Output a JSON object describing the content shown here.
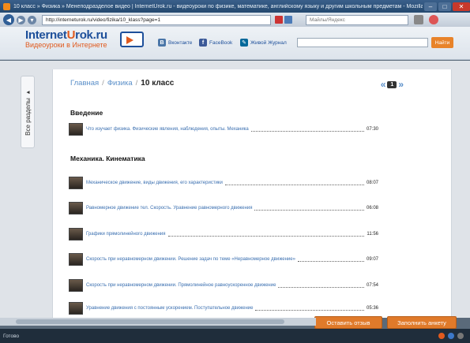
{
  "window": {
    "title": "10 класс » Физика » Менеподразделое видео | InternetUrok.ru - видеоуроки по физике, математике, английскому языку и другим школьным предметам - Mozilla Firefox"
  },
  "browser": {
    "url": "http://interneturok.ru/video/fizika/10_klass?page=1",
    "search_placeholder": "Майлы/Яндекс"
  },
  "site": {
    "logo_name_a": "Internet",
    "logo_name_b": "U",
    "logo_name_c": "rok.ru",
    "tagline": "Видеоуроки в Интернете",
    "social": [
      {
        "icon": "vkontakte-icon",
        "label": "Вконтакте",
        "color": "#4a76a8",
        "glyph": "B"
      },
      {
        "icon": "facebook-icon",
        "label": "FaceBook",
        "color": "#3b5998",
        "glyph": "f"
      },
      {
        "icon": "livejournal-icon",
        "label": "Живой Журнал",
        "color": "#00689a",
        "glyph": "✎"
      }
    ],
    "search_button": "Найти",
    "accent": "#e07a2a"
  },
  "sidebar": {
    "toggle_label": "Все разделы ▸"
  },
  "breadcrumb": {
    "home": "Главная",
    "subject": "Физика",
    "current": "10 класс",
    "sep": "/"
  },
  "pager": {
    "prev": "«",
    "page": "1",
    "next": "»"
  },
  "sections": [
    {
      "title": "Введение",
      "lessons": [
        {
          "title": "Что изучает физика. Физические явления, наблюдения, опыты. Механика",
          "duration": "07:30"
        }
      ]
    },
    {
      "title": "Механика. Кинематика",
      "lessons": [
        {
          "title": "Механическое движение, виды движения, его характеристики",
          "duration": "08:07"
        },
        {
          "title": "Равномерное движение тел. Скорость. Уравнение равномерного движения",
          "duration": "06:08"
        },
        {
          "title": "Графики прямолинейного движения",
          "duration": "11:56"
        },
        {
          "title": "Скорость при неравномерном движении. Решение задач по теме «Неравномерное движение»",
          "duration": "09:07"
        },
        {
          "title": "Скорость при неравномерном движении. Прямолинейное равноускоренное движение",
          "duration": "07:54"
        },
        {
          "title": "Уравнение движения с постоянным ускорением. Поступательное движение",
          "duration": "05:36"
        }
      ]
    }
  ],
  "actions": {
    "feedback": "Оставить отзыв",
    "survey": "Заполнить анкету"
  },
  "status": {
    "text": "Готово"
  }
}
